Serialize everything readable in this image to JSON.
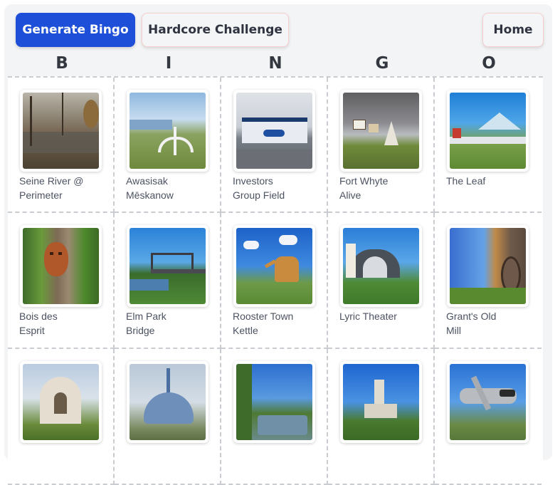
{
  "toolbar": {
    "generate_label": "Generate Bingo",
    "hardcore_label": "Hardcore Challenge",
    "home_label": "Home"
  },
  "header_letters": [
    "B",
    "I",
    "N",
    "G",
    "O"
  ],
  "grid": {
    "rows": [
      [
        {
          "line1": "Seine River @",
          "line2": "Perimeter"
        },
        {
          "line1": "Awasisak",
          "line2": "Mēskanow"
        },
        {
          "line1": "Investors",
          "line2": "Group Field"
        },
        {
          "line1": "Fort Whyte",
          "line2": "Alive"
        },
        {
          "line1": "The Leaf",
          "line2": ""
        }
      ],
      [
        {
          "line1": "Bois des",
          "line2": "Esprit"
        },
        {
          "line1": "Elm Park",
          "line2": "Bridge"
        },
        {
          "line1": "Rooster Town",
          "line2": "Kettle"
        },
        {
          "line1": "Lyric Theater",
          "line2": ""
        },
        {
          "line1": "Grant's Old",
          "line2": "Mill"
        }
      ],
      [
        {
          "line1": "",
          "line2": ""
        },
        {
          "line1": "",
          "line2": ""
        },
        {
          "line1": "",
          "line2": ""
        },
        {
          "line1": "",
          "line2": ""
        },
        {
          "line1": "",
          "line2": ""
        }
      ]
    ]
  },
  "colors": {
    "primary": "#1d4fd8",
    "outline_border": "#f7cdcd",
    "panel_bg": "#f3f4f6"
  }
}
